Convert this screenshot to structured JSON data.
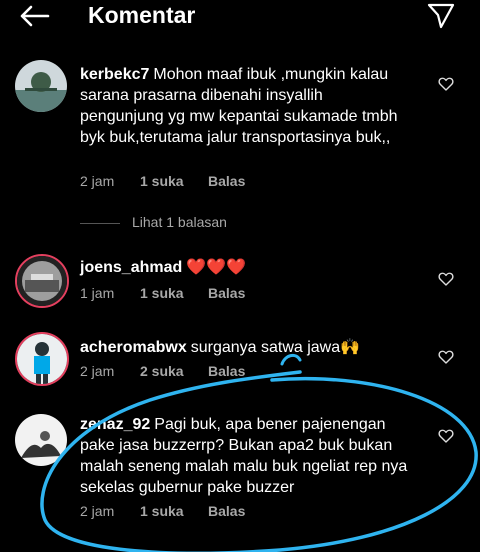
{
  "header": {
    "title": "Komentar"
  },
  "comments": [
    {
      "username": "kerbekc7",
      "text": "Mohon maaf ibuk ,mungkin kalau sarana prasarna dibenahi insyallih pengunjung  yg mw kepantai sukamade tmbh byk buk,terutama jalur transportasinya buk,,",
      "time": "2 jam",
      "likes": "1 suka",
      "reply": "Balas",
      "view_replies": "Lihat 1 balasan"
    },
    {
      "username": "joens_ahmad",
      "text": "❤️❤️❤️",
      "time": "1 jam",
      "likes": "1 suka",
      "reply": "Balas"
    },
    {
      "username": "acheromabwx",
      "text": "surganya satwa jawa🙌",
      "time": "2 jam",
      "likes": "2 suka",
      "reply": "Balas"
    },
    {
      "username": "zenaz_92",
      "text": "Pagi buk, apa bener pajenengan pake jasa buzzerrp? Bukan apa2 buk bukan malah seneng malah malu buk ngeliat rep nya sekelas gubernur pake buzzer",
      "time": "2 jam",
      "likes": "1 suka",
      "reply": "Balas"
    }
  ],
  "colors": {
    "background": "#000000",
    "text": "#ffffff",
    "meta": "#a8a8a8",
    "annotation": "#2fb4f0"
  },
  "icons": {
    "back": "arrow-left-icon",
    "send": "paper-plane-icon",
    "like": "heart-outline-icon"
  }
}
